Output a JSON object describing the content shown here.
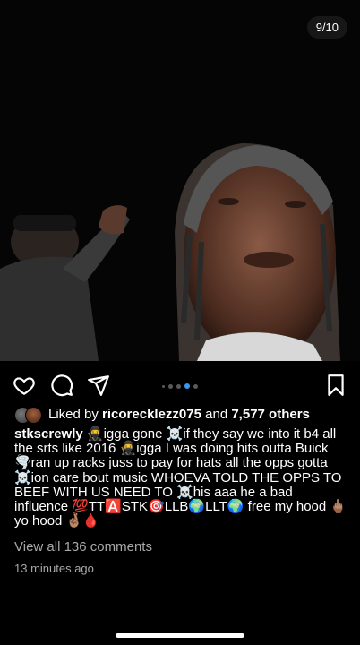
{
  "media": {
    "counter": "9/10"
  },
  "actions": {
    "like_icon": "heart-icon",
    "comment_icon": "comment-icon",
    "share_icon": "paper-plane-icon",
    "save_icon": "bookmark-icon",
    "carousel_total": 10,
    "carousel_current": 9,
    "accent": "#3897f0"
  },
  "likes": {
    "prefix": "Liked by",
    "user": "ricorecklezz075",
    "joiner": "and",
    "others": "7,577 others"
  },
  "caption": {
    "username": "stkscrewly",
    "text": "🥷igga gone ☠️if they say we into it b4 all the srts like 2016 🥷igga I was doing hits outta Buick 🌪️ran up racks juss to pay for hats all the opps gotta ☠️ion care bout music WHOEVA TOLD THE OPPS TO BEEF WITH US NEED TO ☠️his aaa he a bad influence 💯TT🅰️STK🎯LLB🌍LLT🌍 free my hood 🖕🏽yo hood 🤞🏽🩸"
  },
  "comments": {
    "view_all": "View all 136 comments"
  },
  "timestamp": "13 minutes ago"
}
